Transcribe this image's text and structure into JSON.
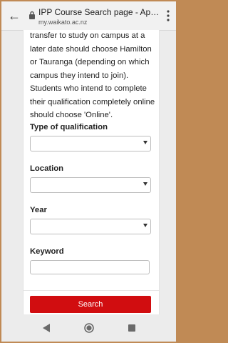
{
  "browser": {
    "page_title": "IPP Course Search page - Appli...",
    "url": "my.waikato.ac.nz"
  },
  "intro_text": "transfer to study on campus at a later date should choose Hamilton or Tauranga (depending on which campus they intend to join). Students who intend to complete their qualification completely online should choose 'Online'.",
  "form": {
    "qualification_label": "Type of qualification",
    "qualification_value": "",
    "location_label": "Location",
    "location_value": "",
    "year_label": "Year",
    "year_value": "",
    "keyword_label": "Keyword",
    "keyword_value": "",
    "search_button": "Search"
  },
  "colors": {
    "accent": "#d10d10",
    "outer_frame": "#c08a55"
  },
  "icons": [
    "back-arrow-icon",
    "lock-icon",
    "more-vert-icon",
    "nav-back-icon",
    "nav-home-icon",
    "nav-recents-icon"
  ]
}
